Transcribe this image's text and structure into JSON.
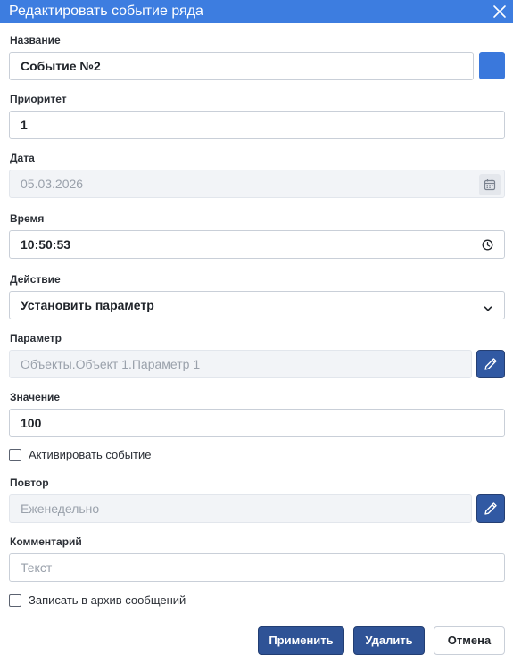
{
  "dialog": {
    "title": "Редактировать событие ряда"
  },
  "fields": {
    "name": {
      "label": "Название",
      "value": "Событие №2",
      "color": "#3a78dc"
    },
    "priority": {
      "label": "Приоритет",
      "value": "1"
    },
    "date": {
      "label": "Дата",
      "value": "05.03.2026"
    },
    "time": {
      "label": "Время",
      "value": "10:50:53"
    },
    "action": {
      "label": "Действие",
      "value": "Установить параметр"
    },
    "parameter": {
      "label": "Параметр",
      "value": "Объекты.Объект 1.Параметр 1"
    },
    "value": {
      "label": "Значение",
      "value": "100"
    },
    "activate": {
      "label": "Активировать событие",
      "checked": false
    },
    "repeat": {
      "label": "Повтор",
      "value": "Еженедельно"
    },
    "comment": {
      "label": "Комментарий",
      "placeholder": "Текст",
      "value": ""
    },
    "archive": {
      "label": "Записать в архив сообщений",
      "checked": false
    }
  },
  "buttons": {
    "apply": "Применить",
    "delete": "Удалить",
    "cancel": "Отмена"
  },
  "colors": {
    "titlebar": "#3d7de0",
    "primary_button": "#2f5396",
    "accent": "#3a78dc"
  },
  "icons": {
    "close": "close-icon",
    "calendar": "calendar-icon",
    "clock": "clock-icon",
    "chevron": "chevron-down-icon",
    "edit": "pencil-icon"
  }
}
